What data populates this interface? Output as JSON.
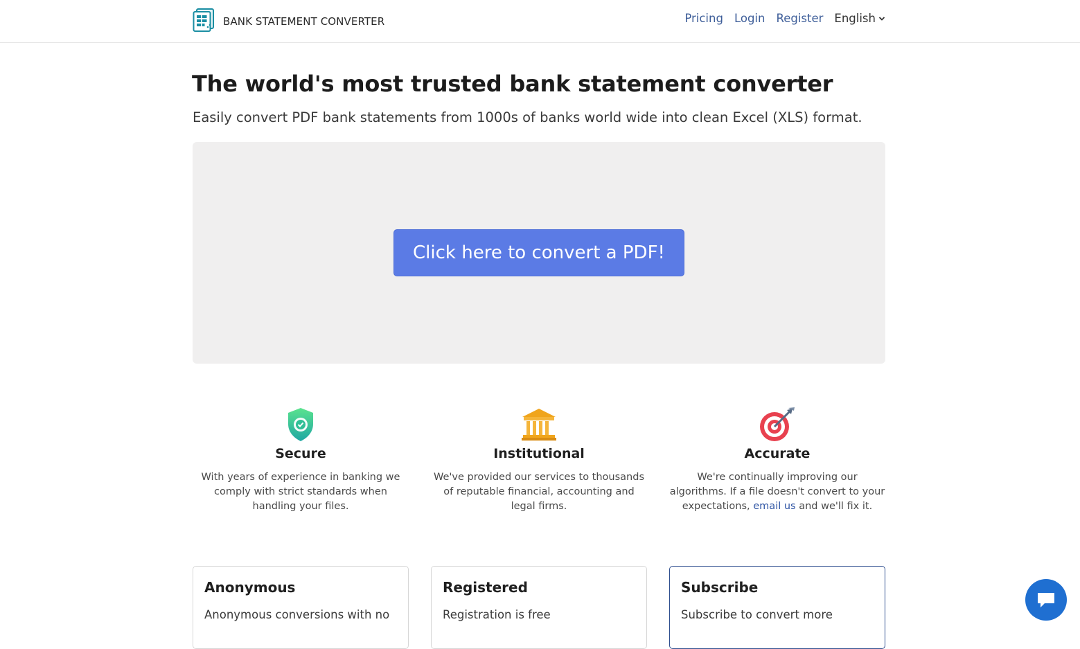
{
  "header": {
    "brand": "BANK STATEMENT CONVERTER",
    "nav": {
      "pricing": "Pricing",
      "login": "Login",
      "register": "Register",
      "language": "English"
    }
  },
  "hero": {
    "title": "The world's most trusted bank statement converter",
    "subtitle": "Easily convert PDF bank statements from 1000s of banks world wide into clean Excel (XLS) format.",
    "cta": "Click here to convert a PDF!"
  },
  "features": [
    {
      "title": "Secure",
      "text": "With years of experience in banking we comply with strict standards when handling your files."
    },
    {
      "title": "Institutional",
      "text": "We've provided our services to thousands of reputable financial, accounting and legal firms."
    },
    {
      "title": "Accurate",
      "text_before": "We're continually improving our algorithms. If a file doesn't convert to your expectations,",
      "link": "email us",
      "text_after": "and we'll fix it."
    }
  ],
  "plans": [
    {
      "title": "Anonymous",
      "text": "Anonymous conversions with no"
    },
    {
      "title": "Registered",
      "text": "Registration is free"
    },
    {
      "title": "Subscribe",
      "text": "Subscribe to convert more"
    }
  ],
  "colors": {
    "accent": "#5b7be5",
    "link": "#3f5f9a",
    "chat": "#1f6fd1",
    "dropzone": "#f0efef"
  },
  "icons": {
    "brand": "spreadsheet-logo-icon",
    "secure": "shield-check-icon",
    "institutional": "bank-building-icon",
    "accurate": "target-arrow-icon",
    "chat": "chat-bubble-icon",
    "language": "chevron-down-icon"
  }
}
